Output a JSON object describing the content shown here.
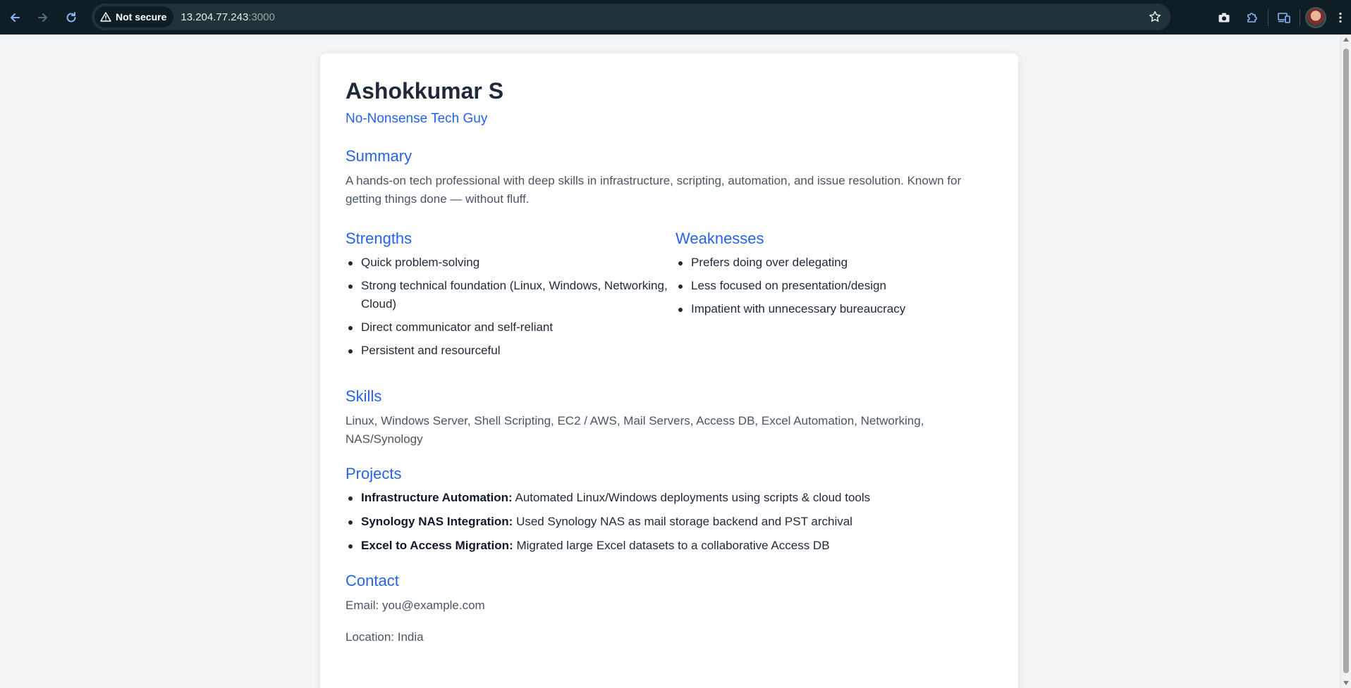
{
  "browser": {
    "security_label": "Not secure",
    "url_host": "13.204.77.243",
    "url_port": ":3000"
  },
  "resume": {
    "name": "Ashokkumar S",
    "tagline": "No-Nonsense Tech Guy",
    "summary": {
      "title": "Summary",
      "text": "A hands-on tech professional with deep skills in infrastructure, scripting, automation, and issue resolution. Known for getting things done — without fluff."
    },
    "strengths": {
      "title": "Strengths",
      "items": [
        "Quick problem-solving",
        "Strong technical foundation (Linux, Windows, Networking, Cloud)",
        "Direct communicator and self-reliant",
        "Persistent and resourceful"
      ]
    },
    "weaknesses": {
      "title": "Weaknesses",
      "items": [
        "Prefers doing over delegating",
        "Less focused on presentation/design",
        "Impatient with unnecessary bureaucracy"
      ]
    },
    "skills": {
      "title": "Skills",
      "text": "Linux, Windows Server, Shell Scripting, EC2 / AWS, Mail Servers, Access DB, Excel Automation, Networking, NAS/Synology"
    },
    "projects": {
      "title": "Projects",
      "items": [
        {
          "name": "Infrastructure Automation:",
          "desc": " Automated Linux/Windows deployments using scripts & cloud tools"
        },
        {
          "name": "Synology NAS Integration:",
          "desc": " Used Synology NAS as mail storage backend and PST archival"
        },
        {
          "name": "Excel to Access Migration:",
          "desc": " Migrated large Excel datasets to a collaborative Access DB"
        }
      ]
    },
    "contact": {
      "title": "Contact",
      "email": "Email: you@example.com",
      "location": "Location: India"
    }
  },
  "icons": {
    "back": "arrow-left-icon",
    "forward": "arrow-right-icon",
    "reload": "reload-icon",
    "warning": "warning-triangle-icon",
    "bookmark": "star-icon",
    "screenshot": "camera-icon",
    "extensions": "puzzle-icon",
    "cast": "devices-icon",
    "menu": "kebab-menu-icon"
  }
}
